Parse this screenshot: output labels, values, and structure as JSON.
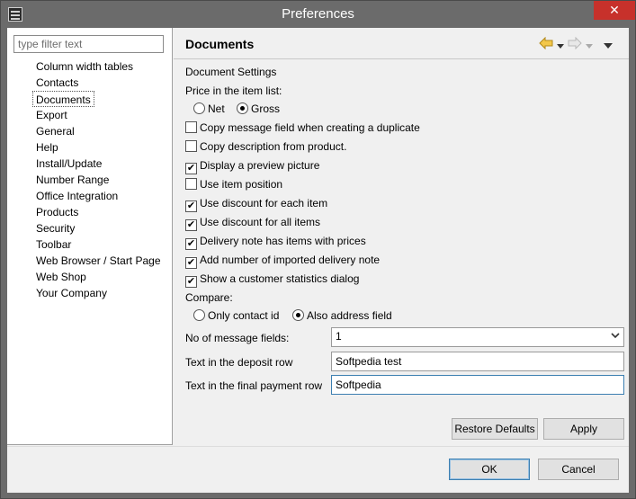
{
  "window": {
    "title": "Preferences",
    "close_label": "✕"
  },
  "filter": {
    "placeholder": "type filter text"
  },
  "tree": {
    "items": [
      "Column width tables",
      "Contacts",
      "Documents",
      "Export",
      "General",
      "Help",
      "Install/Update",
      "Number Range",
      "Office Integration",
      "Products",
      "Security",
      "Toolbar",
      "Web Browser / Start Page",
      "Web Shop",
      "Your Company"
    ],
    "selected": "Documents"
  },
  "page": {
    "title": "Documents",
    "group_label": "Document Settings",
    "price_label": "Price in the item list:",
    "price_options": [
      {
        "label": "Net",
        "selected": false
      },
      {
        "label": "Gross",
        "selected": true
      }
    ],
    "checkboxes": [
      {
        "label": "Copy message field when creating a duplicate",
        "checked": false
      },
      {
        "label": "Copy description from product.",
        "checked": false
      },
      {
        "label": "Display a preview picture",
        "checked": true
      },
      {
        "label": "Use item position",
        "checked": false
      },
      {
        "label": "Use discount for each item",
        "checked": true
      },
      {
        "label": "Use discount for all items",
        "checked": true
      },
      {
        "label": "Delivery note has items with prices",
        "checked": true
      },
      {
        "label": "Add number of imported delivery note",
        "checked": true
      },
      {
        "label": "Show a customer statistics dialog",
        "checked": true
      }
    ],
    "compare_label": "Compare:",
    "compare_options": [
      {
        "label": "Only contact id",
        "selected": false
      },
      {
        "label": "Also address field",
        "selected": true
      }
    ],
    "message_fields_label": "No of message fields:",
    "message_fields_value": "1",
    "deposit_label": "Text in the deposit row",
    "deposit_value": "Softpedia test",
    "final_label": "Text in the final payment row",
    "final_value": "Softpedia",
    "restore_label": "Restore Defaults",
    "apply_label": "Apply"
  },
  "dialog": {
    "ok_label": "OK",
    "cancel_label": "Cancel"
  },
  "colors": {
    "titlebar": "#6b6b6b",
    "close": "#c7312b",
    "arrow": "#e0b020"
  }
}
